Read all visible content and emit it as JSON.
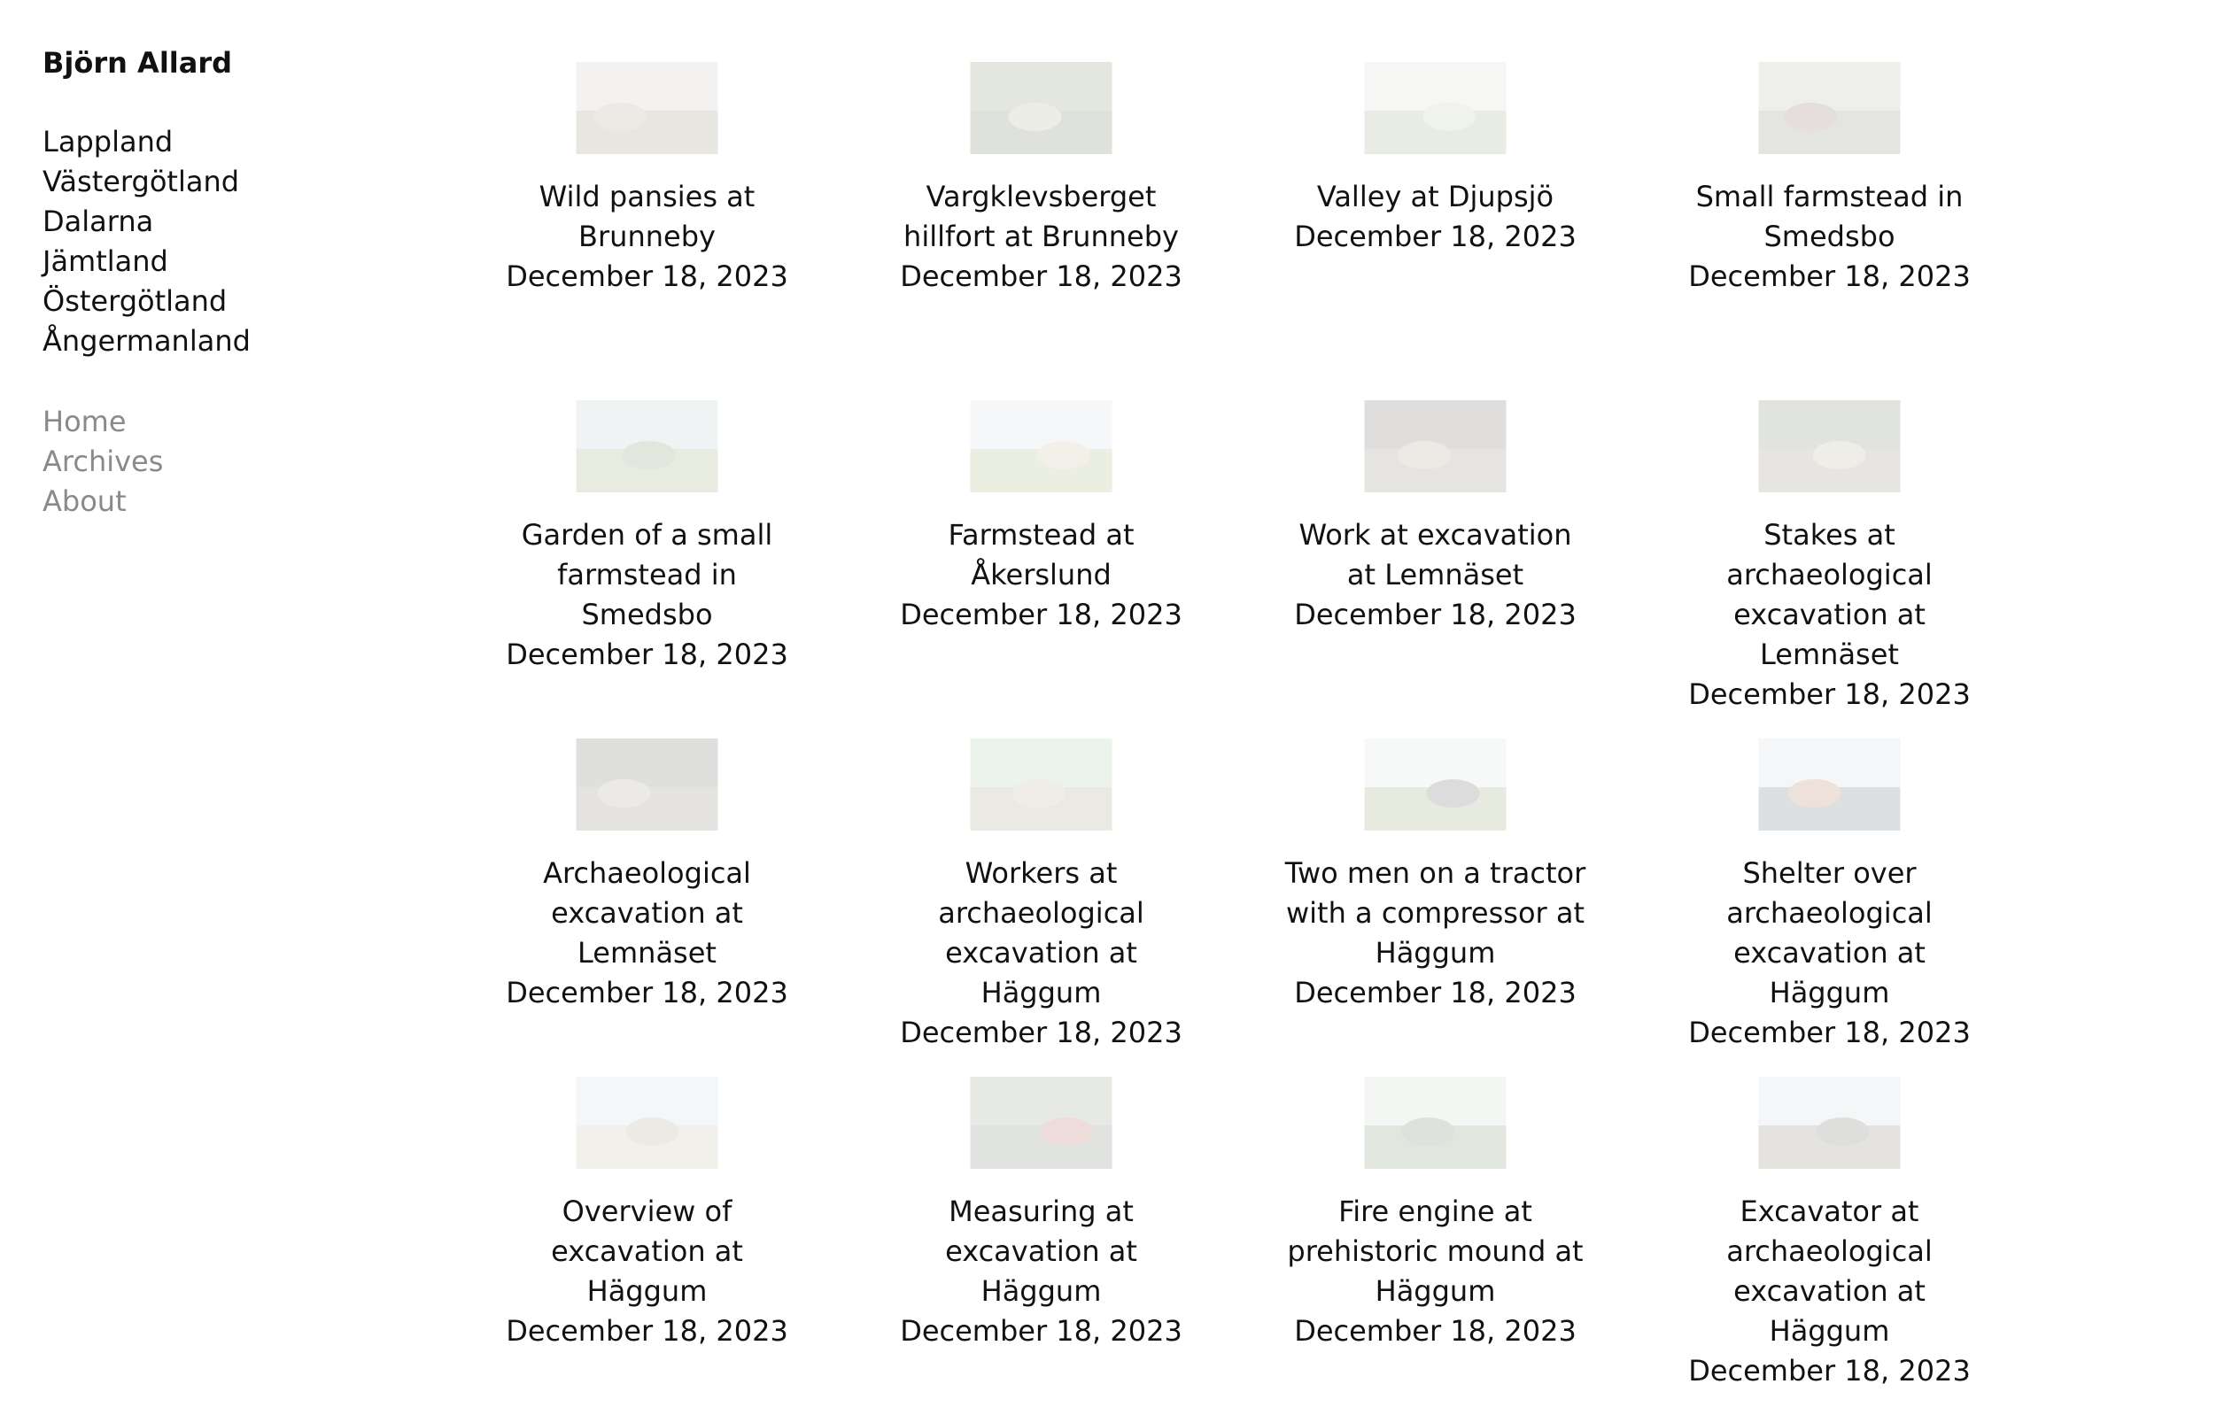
{
  "site": {
    "title": "Björn Allard"
  },
  "regions": [
    "Lappland",
    "Västergötland",
    "Dalarna",
    "Jämtland",
    "Östergötland",
    "Ångermanland"
  ],
  "nav": [
    "Home",
    "Archives",
    "About"
  ],
  "posts": [
    {
      "title": "Wild pansies at Brunneby",
      "date": "December 18, 2023",
      "thumb": {
        "sky": "#b8b3a4",
        "ground": "#6f6a4e",
        "accent": "#8a7f5f"
      }
    },
    {
      "title": "Vargklevsberget hillfort at Brunneby",
      "date": "December 18, 2023",
      "thumb": {
        "sky": "#5d6b44",
        "ground": "#3f4a2e",
        "accent": "#8e9b6a"
      }
    },
    {
      "title": "Valley at Djupsjö",
      "date": "December 18, 2023",
      "thumb": {
        "sky": "#c9cdc2",
        "ground": "#7d8a63",
        "accent": "#a9b190"
      }
    },
    {
      "title": "Small farmstead in Smedsbo",
      "date": "December 18, 2023",
      "thumb": {
        "sky": "#9aa08b",
        "ground": "#5e6446",
        "accent": "#6b3a2c"
      }
    },
    {
      "title": "Garden of a small farmstead in Smedsbo",
      "date": "December 18, 2023",
      "thumb": {
        "sky": "#a7b6c2",
        "ground": "#6f8a45",
        "accent": "#4f6b35"
      }
    },
    {
      "title": "Farmstead at Åkerslund",
      "date": "December 18, 2023",
      "thumb": {
        "sky": "#c7d4de",
        "ground": "#7fa04e",
        "accent": "#b9a585"
      }
    },
    {
      "title": "Work at excavation at Lemnäset",
      "date": "December 18, 2023",
      "thumb": {
        "sky": "#3c3a30",
        "ground": "#6b6048",
        "accent": "#8f8565"
      }
    },
    {
      "title": "Stakes at archaeological excavation at Lemnäset",
      "date": "December 18, 2023",
      "thumb": {
        "sky": "#4d5540",
        "ground": "#6f6650",
        "accent": "#9d9377"
      }
    },
    {
      "title": "Archaeological excavation at Lemnäset",
      "date": "December 18, 2023",
      "thumb": {
        "sky": "#3e4434",
        "ground": "#5f5947",
        "accent": "#8b8368"
      }
    },
    {
      "title": "Workers at archaeological excavation at Häggum",
      "date": "December 18, 2023",
      "thumb": {
        "sky": "#8fb08d",
        "ground": "#8a7a5a",
        "accent": "#a69273"
      }
    },
    {
      "title": "Two men on a tractor with a compressor at Häggum",
      "date": "December 18, 2023",
      "thumb": {
        "sky": "#cfd6d8",
        "ground": "#6f8a3f",
        "accent": "#2f2f2a"
      }
    },
    {
      "title": "Shelter over archaeological excavation at Häggum",
      "date": "December 18, 2023",
      "thumb": {
        "sky": "#c8ccd0",
        "ground": "#35475a",
        "accent": "#9b4a22"
      }
    },
    {
      "title": "Overview of excavation at Häggum",
      "date": "December 18, 2023",
      "thumb": {
        "sky": "#b9d3e6",
        "ground": "#b4a785",
        "accent": "#8c7f63"
      }
    },
    {
      "title": "Measuring at excavation at Häggum",
      "date": "December 18, 2023",
      "thumb": {
        "sky": "#6f7b5b",
        "ground": "#4d5544",
        "accent": "#9b2f22"
      }
    },
    {
      "title": "Fire engine at prehistoric mound at Häggum",
      "date": "December 18, 2023",
      "thumb": {
        "sky": "#b7cdb5",
        "ground": "#4e6b3a",
        "accent": "#3a4a2f"
      }
    },
    {
      "title": "Excavator at archaeological excavation at Häggum",
      "date": "December 18, 2023",
      "thumb": {
        "sky": "#c7cdd2",
        "ground": "#5b5648",
        "accent": "#3a3a34"
      }
    }
  ]
}
